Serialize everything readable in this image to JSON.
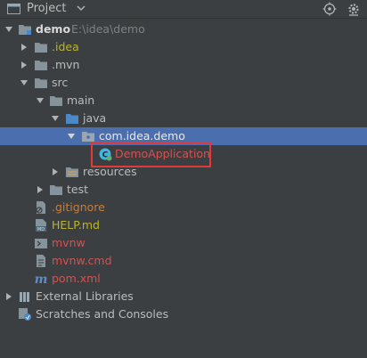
{
  "header": {
    "title": "Project",
    "icons": [
      "project-icon",
      "chevron-down-icon",
      "target-icon",
      "settings-icon"
    ]
  },
  "tree": {
    "root": {
      "name": "demo",
      "path": "E:\\idea\\demo"
    },
    "idea": ".idea",
    "mvn": ".mvn",
    "src": "src",
    "main": "main",
    "java": "java",
    "package": "com.idea.demo",
    "app_class": "DemoApplication",
    "resources": "resources",
    "test": "test",
    "gitignore": ".gitignore",
    "help": "HELP.md",
    "mvnw": "mvnw",
    "mvnw_cmd": "mvnw.cmd",
    "pom": "pom.xml",
    "external_libraries": "External Libraries",
    "scratches": "Scratches and Consoles"
  },
  "colors": {
    "background": "#3c3f41",
    "selection": "#4b6eaf",
    "highlight_border": "#e03a3a",
    "ignored_text": "#d25252",
    "idea_folder_text": "#bbb529",
    "modified_text": "#c77d3a"
  }
}
